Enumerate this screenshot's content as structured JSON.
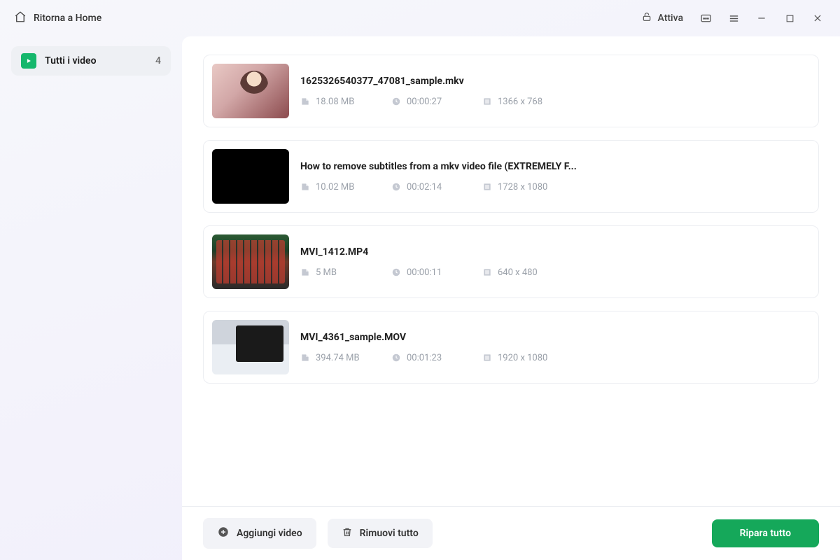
{
  "titlebar": {
    "home_label": "Ritorna a Home",
    "activate_label": "Attiva"
  },
  "sidebar": {
    "all_videos_label": "Tutti i video",
    "count": "4"
  },
  "videos": [
    {
      "name": "1625326540377_47081_sample.mkv",
      "size": "18.08 MB",
      "duration": "00:00:27",
      "resolution": "1366 x 768",
      "thumb": "t1"
    },
    {
      "name": "How to remove subtitles from a mkv video file (EXTREMELY F...",
      "size": "10.02 MB",
      "duration": "00:02:14",
      "resolution": "1728 x 1080",
      "thumb": "t2"
    },
    {
      "name": "MVI_1412.MP4",
      "size": "5 MB",
      "duration": "00:00:11",
      "resolution": "640 x 480",
      "thumb": "t3"
    },
    {
      "name": "MVI_4361_sample.MOV",
      "size": "394.74 MB",
      "duration": "00:01:23",
      "resolution": "1920 x 1080",
      "thumb": "t4"
    }
  ],
  "footer": {
    "add_label": "Aggiungi video",
    "remove_label": "Rimuovi tutto",
    "repair_label": "Ripara tutto"
  }
}
